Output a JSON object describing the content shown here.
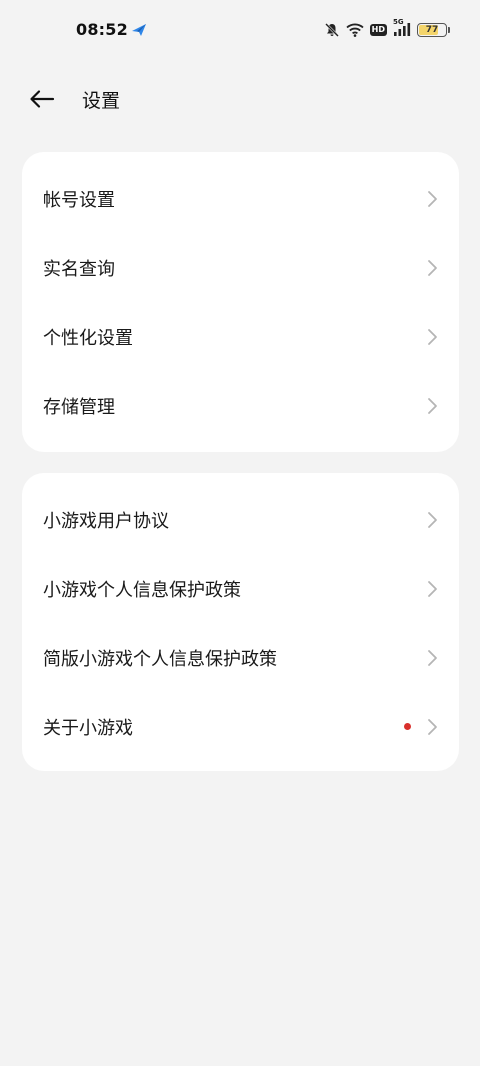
{
  "status_bar": {
    "time": "08:52",
    "network_type": "5G",
    "hd_label": "HD",
    "battery_level": "77",
    "battery_fraction": 0.77
  },
  "header": {
    "title": "设置"
  },
  "sections": [
    {
      "items": [
        {
          "label": "帐号设置"
        },
        {
          "label": "实名查询"
        },
        {
          "label": "个性化设置"
        },
        {
          "label": "存储管理"
        }
      ]
    },
    {
      "items": [
        {
          "label": "小游戏用户协议"
        },
        {
          "label": "小游戏个人信息保护政策"
        },
        {
          "label": "简版小游戏个人信息保护政策"
        },
        {
          "label": "关于小游戏",
          "badge": "red-dot"
        }
      ]
    }
  ],
  "colors": {
    "background": "#f3f3f3",
    "card": "#ffffff",
    "badge": "#d9302c",
    "battery_fill": "#f4d56b",
    "chevron": "#b5b5b5"
  },
  "icons": [
    "back-arrow-icon",
    "chevron-right-icon",
    "mute-bell-icon",
    "wifi-icon",
    "signal-icon",
    "battery-icon",
    "app-indicator-icon"
  ]
}
